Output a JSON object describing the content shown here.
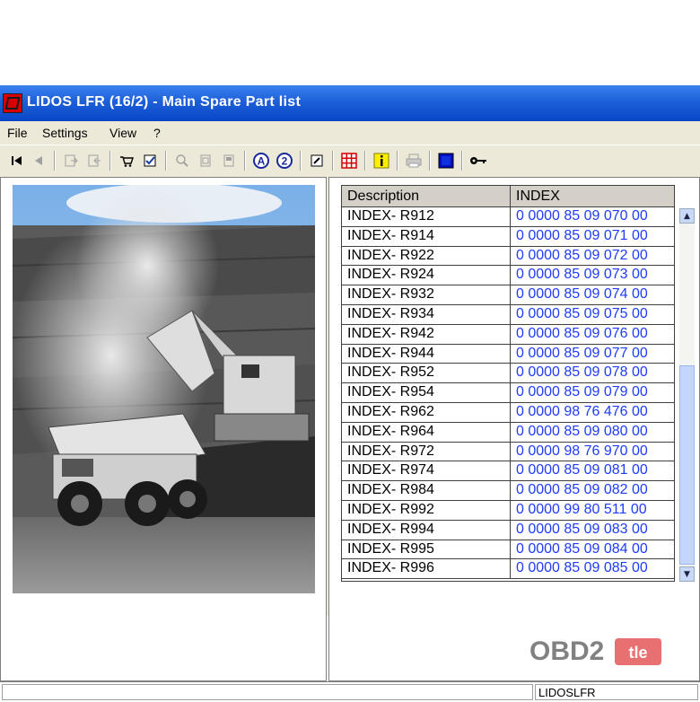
{
  "window": {
    "title": "LIDOS LFR (16/2) - Main Spare Part list",
    "accent": "#0a46c8"
  },
  "menu": {
    "items": [
      {
        "label": "File"
      },
      {
        "label": "Settings"
      },
      {
        "label": "View"
      },
      {
        "label": "?"
      }
    ]
  },
  "toolbar": {
    "icons": [
      "first-record-icon",
      "previous-record-icon",
      "export-icon",
      "import-icon",
      "cart-icon",
      "checklist-icon",
      "zoom-in-icon",
      "page-icon",
      "page-alt-icon",
      "search-a-icon",
      "search-2-icon",
      "edit-icon",
      "grid-icon",
      "info-icon",
      "print-icon",
      "color-icon",
      "key-icon"
    ]
  },
  "table": {
    "headers": {
      "description": "Description",
      "index": "INDEX"
    },
    "rows": [
      {
        "description": "INDEX- R912",
        "index": "0 0000  85 09 070 00"
      },
      {
        "description": "INDEX- R914",
        "index": "0 0000  85 09 071 00"
      },
      {
        "description": "INDEX- R922",
        "index": "0 0000  85 09 072 00"
      },
      {
        "description": "INDEX- R924",
        "index": "0 0000  85 09 073 00"
      },
      {
        "description": "INDEX- R932",
        "index": "0 0000  85 09 074 00"
      },
      {
        "description": "INDEX- R934",
        "index": "0 0000  85 09 075 00"
      },
      {
        "description": "INDEX- R942",
        "index": "0 0000  85 09 076 00"
      },
      {
        "description": "INDEX- R944",
        "index": "0 0000  85 09 077 00"
      },
      {
        "description": "INDEX- R952",
        "index": "0 0000  85 09 078 00"
      },
      {
        "description": "INDEX- R954",
        "index": "0 0000  85 09 079 00"
      },
      {
        "description": "INDEX- R962",
        "index": "0 0000  98 76 476 00"
      },
      {
        "description": "INDEX- R964",
        "index": "0 0000  85 09 080 00"
      },
      {
        "description": "INDEX- R972",
        "index": "0 0000  98 76 970 00"
      },
      {
        "description": "INDEX- R974",
        "index": "0 0000  85 09 081 00"
      },
      {
        "description": "INDEX- R984",
        "index": "0 0000  85 09 082 00"
      },
      {
        "description": "INDEX- R992",
        "index": "0 0000  99 80 511 00"
      },
      {
        "description": "INDEX- R994",
        "index": "0 0000  85 09 083 00"
      },
      {
        "description": "INDEX- R995",
        "index": "0 0000  85 09 084 00"
      },
      {
        "description": "INDEX- R996",
        "index": "0 0000  85 09 085 00"
      }
    ]
  },
  "watermark": {
    "text": "OBD2 tle"
  },
  "status": {
    "segment1": "",
    "segment2": "LIDOSLFR"
  }
}
